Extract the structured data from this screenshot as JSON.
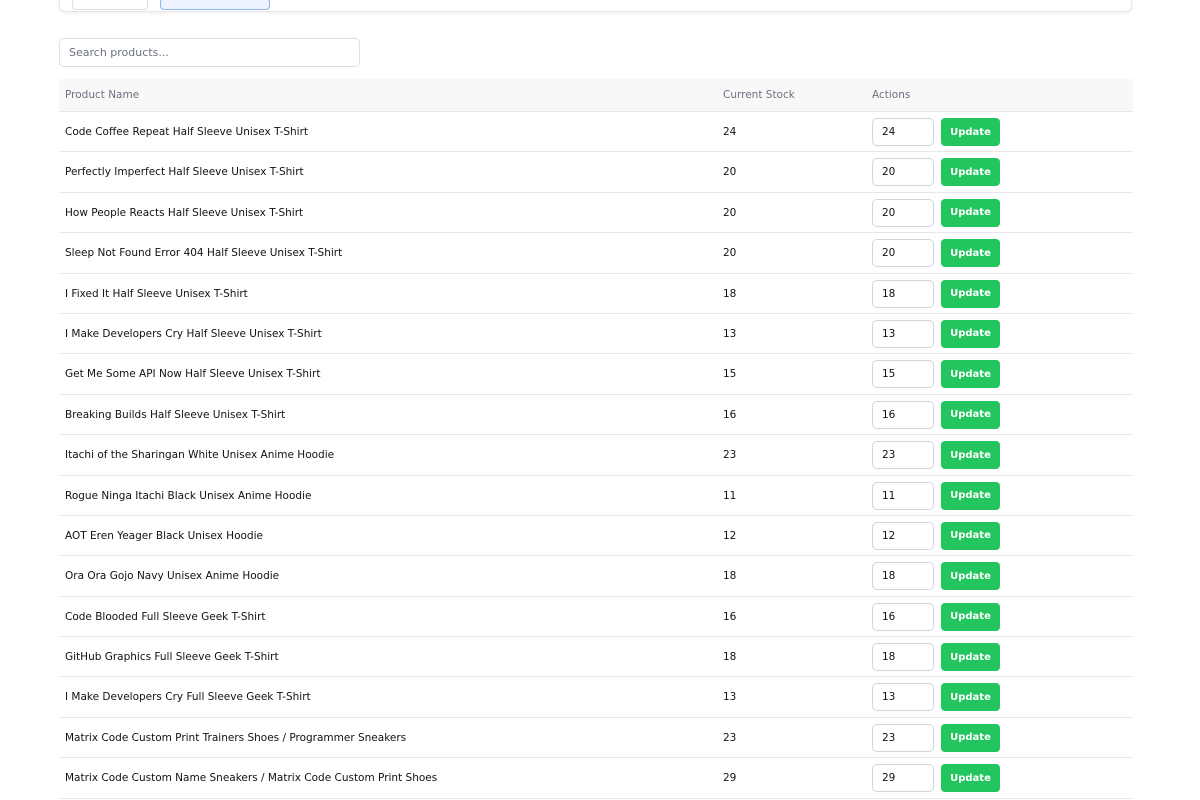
{
  "search": {
    "placeholder": "Search products..."
  },
  "table": {
    "headers": {
      "name": "Product Name",
      "stock": "Current Stock",
      "actions": "Actions"
    },
    "update_label": "Update",
    "rows": [
      {
        "name": "Code Coffee Repeat Half Sleeve Unisex T-Shirt",
        "stock": "24",
        "input": "24"
      },
      {
        "name": "Perfectly Imperfect Half Sleeve Unisex T-Shirt",
        "stock": "20",
        "input": "20"
      },
      {
        "name": "How People Reacts Half Sleeve Unisex T-Shirt",
        "stock": "20",
        "input": "20"
      },
      {
        "name": "Sleep Not Found Error 404 Half Sleeve Unisex T-Shirt",
        "stock": "20",
        "input": "20"
      },
      {
        "name": "I Fixed It Half Sleeve Unisex T-Shirt",
        "stock": "18",
        "input": "18"
      },
      {
        "name": "I Make Developers Cry Half Sleeve Unisex T-Shirt",
        "stock": "13",
        "input": "13"
      },
      {
        "name": "Get Me Some API Now Half Sleeve Unisex T-Shirt",
        "stock": "15",
        "input": "15"
      },
      {
        "name": "Breaking Builds Half Sleeve Unisex T-Shirt",
        "stock": "16",
        "input": "16"
      },
      {
        "name": "Itachi of the Sharingan White Unisex Anime Hoodie",
        "stock": "23",
        "input": "23"
      },
      {
        "name": "Rogue Ninga Itachi Black Unisex Anime Hoodie",
        "stock": "11",
        "input": "11"
      },
      {
        "name": "AOT Eren Yeager Black Unisex Hoodie",
        "stock": "12",
        "input": "12"
      },
      {
        "name": "Ora Ora Gojo Navy Unisex Anime Hoodie",
        "stock": "18",
        "input": "18"
      },
      {
        "name": "Code Blooded Full Sleeve Geek T-Shirt",
        "stock": "16",
        "input": "16"
      },
      {
        "name": "GitHub Graphics Full Sleeve Geek T-Shirt",
        "stock": "18",
        "input": "18"
      },
      {
        "name": "I Make Developers Cry Full Sleeve Geek T-Shirt",
        "stock": "13",
        "input": "13"
      },
      {
        "name": "Matrix Code Custom Print Trainers Shoes / Programmer Sneakers",
        "stock": "23",
        "input": "23"
      },
      {
        "name": "Matrix Code Custom Name Sneakers / Matrix Code Custom Print Shoes",
        "stock": "29",
        "input": "29"
      }
    ]
  },
  "colors": {
    "accent": "#22c55e",
    "header_bg": "#f8f8f8",
    "border": "#e5e7eb"
  }
}
